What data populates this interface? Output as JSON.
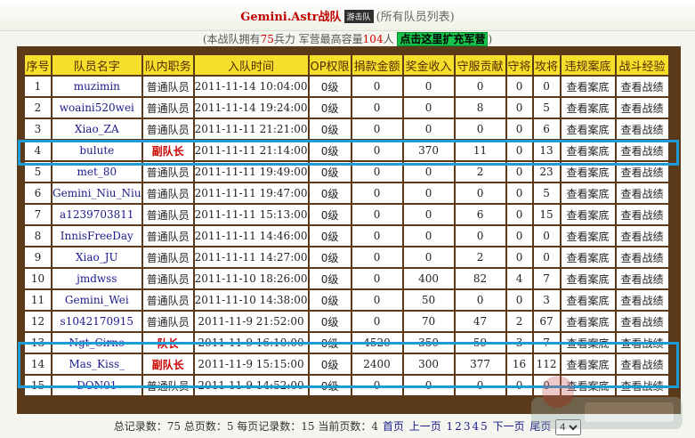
{
  "header": {
    "team_name": "Gemini.Astr",
    "team_word": "战队",
    "badge": "游击队",
    "subtitle": "(所有队员列表)"
  },
  "info": {
    "prefix": "(本战队拥有",
    "soldiers": "75",
    "mid": "兵力 军营最高容量",
    "capacity": "104",
    "suffix": "人",
    "link": "点击这里扩充军营",
    "close": ")"
  },
  "table": {
    "headers": [
      "序号",
      "队员名字",
      "队内职务",
      "入队时间",
      "OP权限",
      "捐款金额",
      "奖金收入",
      "守服贡献",
      "守将",
      "攻将",
      "违规案底",
      "战斗经验"
    ],
    "rows": [
      [
        "1",
        "muzimin",
        "普通队员",
        "2011-11-14 10:04:00",
        "0级",
        "0",
        "0",
        "0",
        "0",
        "0",
        "查看案底",
        "查看战绩"
      ],
      [
        "2",
        "woaini520wei",
        "普通队员",
        "2011-11-14 19:24:00",
        "0级",
        "0",
        "0",
        "8",
        "0",
        "5",
        "查看案底",
        "查看战绩"
      ],
      [
        "3",
        "Xiao_ZA",
        "普通队员",
        "2011-11-11 21:21:00",
        "0级",
        "0",
        "0",
        "0",
        "0",
        "6",
        "查看案底",
        "查看战绩"
      ],
      [
        "4",
        "bulute",
        "副队长",
        "2011-11-11 21:14:00",
        "0级",
        "0",
        "370",
        "11",
        "0",
        "13",
        "查看案底",
        "查看战绩"
      ],
      [
        "5",
        "met_80",
        "普通队员",
        "2011-11-11 19:49:00",
        "0级",
        "0",
        "0",
        "2",
        "0",
        "23",
        "查看案底",
        "查看战绩"
      ],
      [
        "6",
        "Gemini_Niu_Niu",
        "普通队员",
        "2011-11-11 19:47:00",
        "0级",
        "0",
        "0",
        "0",
        "0",
        "5",
        "查看案底",
        "查看战绩"
      ],
      [
        "7",
        "a1239703811",
        "普通队员",
        "2011-11-11 15:13:00",
        "0级",
        "0",
        "0",
        "6",
        "0",
        "15",
        "查看案底",
        "查看战绩"
      ],
      [
        "8",
        "InnisFreeDay",
        "普通队员",
        "2011-11-11 14:46:00",
        "0级",
        "0",
        "0",
        "0",
        "0",
        "0",
        "查看案底",
        "查看战绩"
      ],
      [
        "9",
        "Xiao_JU",
        "普通队员",
        "2011-11-11 14:27:00",
        "0级",
        "0",
        "0",
        "2",
        "0",
        "0",
        "查看案底",
        "查看战绩"
      ],
      [
        "10",
        "jmdwss",
        "普通队员",
        "2011-11-10 18:26:00",
        "0级",
        "0",
        "400",
        "82",
        "4",
        "7",
        "查看案底",
        "查看战绩"
      ],
      [
        "11",
        "Gemini_Wei",
        "普通队员",
        "2011-11-10 14:38:00",
        "0级",
        "0",
        "50",
        "0",
        "0",
        "3",
        "查看案底",
        "查看战绩"
      ],
      [
        "12",
        "s1042170915",
        "普通队员",
        "2011-11-9 21:52:00",
        "0级",
        "0",
        "70",
        "47",
        "2",
        "67",
        "查看案底",
        "查看战绩"
      ],
      [
        "13",
        "Ngt_Cirno",
        "队长",
        "2011-11-9 16:10:00",
        "0级",
        "4520",
        "350",
        "59",
        "3",
        "7",
        "查看案底",
        "查看战绩"
      ],
      [
        "14",
        "Mas_Kiss_",
        "副队长",
        "2011-11-9 15:15:00",
        "0级",
        "2400",
        "300",
        "377",
        "16",
        "112",
        "查看案底",
        "查看战绩"
      ],
      [
        "15",
        "DON01",
        "普通队员",
        "2011-11-9 14:52:00",
        "0级",
        "0",
        "0",
        "0",
        "0",
        "0",
        "查看案底",
        "查看战绩"
      ]
    ],
    "leader_roles": [
      "副队长",
      "队长"
    ]
  },
  "footer": {
    "summary": "总记录数：75 总页数：5 每页记录数：15 当前页数：4",
    "first": "首页",
    "prev": "上一页",
    "pages": [
      "1",
      "2",
      "3",
      "4",
      "5"
    ],
    "next": "下一页",
    "last": "尾页",
    "page_select": "4"
  },
  "colors": {
    "header_bg": "#f6df2b",
    "frame": "#5a3a18",
    "highlight": "#1e9ad6",
    "role_red": "#cc0000"
  }
}
